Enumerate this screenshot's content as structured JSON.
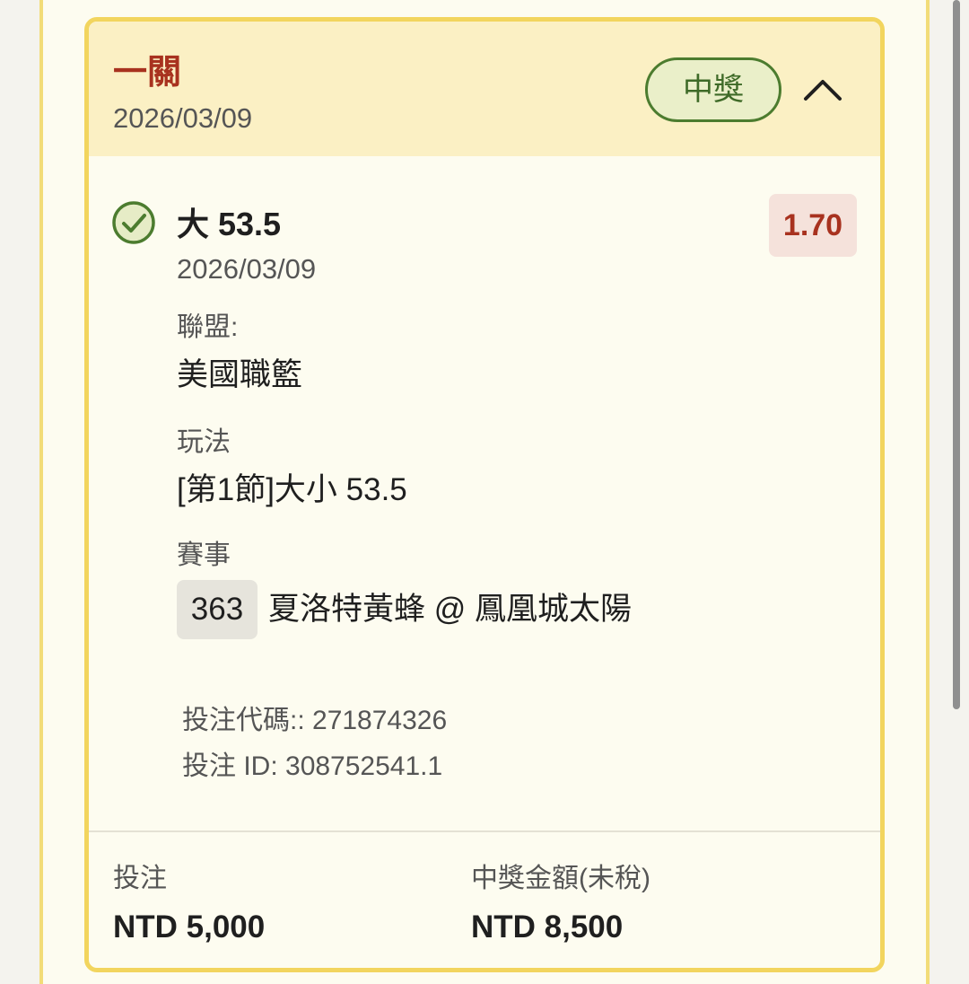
{
  "bet": {
    "type": "一關",
    "date": "2026/03/09",
    "status": "中獎",
    "selection": {
      "title": "大 53.5",
      "date": "2026/03/09",
      "odds": "1.70",
      "league_label": "聯盟:",
      "league": "美國職籃",
      "market_label": "玩法",
      "market": "[第1節]大小 53.5",
      "event_label": "賽事",
      "event_number": "363",
      "event": "夏洛特黃蜂 @ 鳳凰城太陽"
    },
    "bet_code": "投注代碼:: 271874326",
    "bet_id": "投注 ID: 308752541.1",
    "stake_label": "投注",
    "stake": "NTD 5,000",
    "payout_label": "中獎金額(未稅)",
    "payout": "NTD 8,500"
  },
  "colors": {
    "accent_red": "#a8321f",
    "win_green": "#4c7c2f",
    "card_border": "#f2d55e",
    "header_bg": "#fbf0c4"
  },
  "icons": {
    "status": "check-circle-icon",
    "toggle": "chevron-up-icon"
  }
}
